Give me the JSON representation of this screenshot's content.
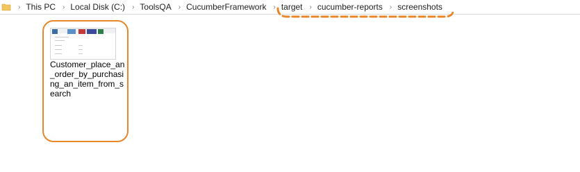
{
  "breadcrumb": {
    "items": [
      "This PC",
      "Local Disk (C:)",
      "ToolsQA",
      "CucumberFramework",
      "target",
      "cucumber-reports",
      "screenshots"
    ]
  },
  "colors": {
    "highlight": "#e8862a",
    "folder": "#f3c55d"
  },
  "icons": {
    "folder": "folder-icon",
    "separator": "chevron-right-icon"
  },
  "files": [
    {
      "name": "Customer_place_an_order_by_purchasing_an_item_from_search"
    }
  ]
}
